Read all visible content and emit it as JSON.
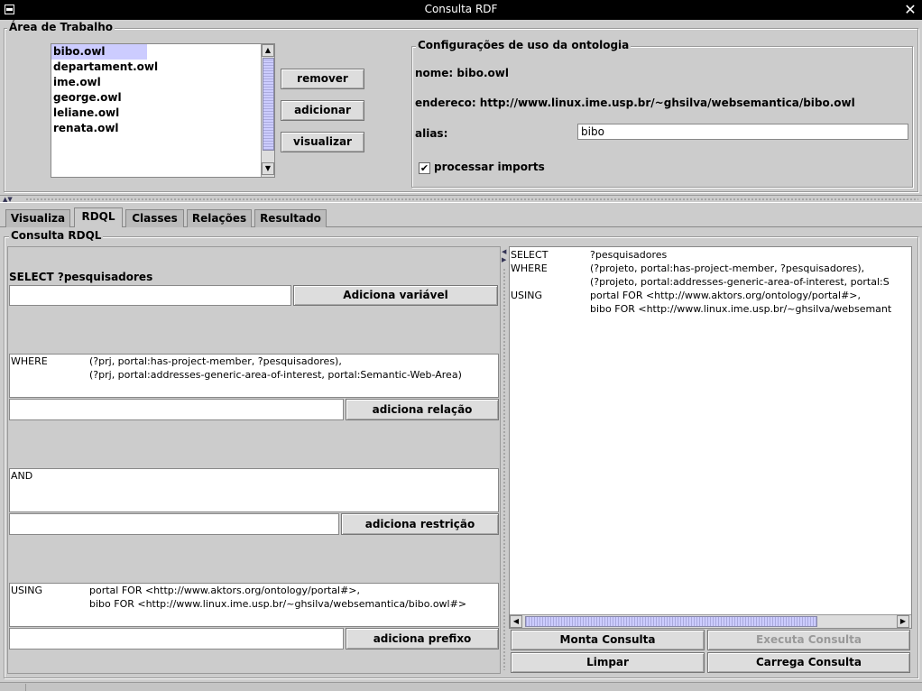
{
  "window": {
    "title": "Consulta RDF"
  },
  "workspace": {
    "legend": "Área de Trabalho",
    "ontologies": [
      "bibo.owl",
      "departament.owl",
      "ime.owl",
      "george.owl",
      "leliane.owl",
      "renata.owl"
    ],
    "selected_index": 0,
    "buttons": {
      "remove": "remover",
      "add": "adicionar",
      "view": "visualizar"
    }
  },
  "config": {
    "legend": "Configurações de uso da ontologia",
    "name_line": "nome: bibo.owl",
    "address_line": "endereco: http://www.linux.ime.usp.br/~ghsilva/websemantica/bibo.owl",
    "alias_label": "alias:",
    "alias_value": "bibo",
    "imports_label": "processar imports",
    "imports_checked": true
  },
  "tabs": [
    "Visualiza",
    "RDQL",
    "Classes",
    "Relações",
    "Resultado"
  ],
  "active_tab": "RDQL",
  "rdql": {
    "legend": "Consulta RDQL",
    "select_text": "SELECT ?pesquisadores",
    "add_variable_button": "Adiciona variável",
    "where_keyword": "WHERE",
    "where_lines": [
      "(?prj, portal:has-project-member, ?pesquisadores),",
      "(?prj, portal:addresses-generic-area-of-interest, portal:Semantic-Web-Area)"
    ],
    "add_relation_button": "adiciona relação",
    "and_keyword": "AND",
    "add_restriction_button": "adiciona restrição",
    "using_keyword": "USING",
    "using_lines": [
      "portal FOR <http://www.aktors.org/ontology/portal#>,",
      "bibo FOR <http://www.linux.ime.usp.br/~ghsilva/websemantica/bibo.owl#>"
    ],
    "add_prefix_button": "adiciona prefixo"
  },
  "query_preview": {
    "rows": [
      {
        "keyword": "SELECT",
        "text": "?pesquisadores"
      },
      {
        "keyword": "WHERE",
        "text": "(?projeto, portal:has-project-member, ?pesquisadores),"
      },
      {
        "keyword": "",
        "text": "(?projeto, portal:addresses-generic-area-of-interest, portal:S"
      },
      {
        "keyword": "USING",
        "text": "portal FOR <http://www.aktors.org/ontology/portal#>,"
      },
      {
        "keyword": "",
        "text": "bibo FOR <http://www.linux.ime.usp.br/~ghsilva/websemant"
      }
    ]
  },
  "actions": {
    "build": "Monta Consulta",
    "execute": "Executa Consulta",
    "clear": "Limpar",
    "load": "Carrega Consulta"
  }
}
